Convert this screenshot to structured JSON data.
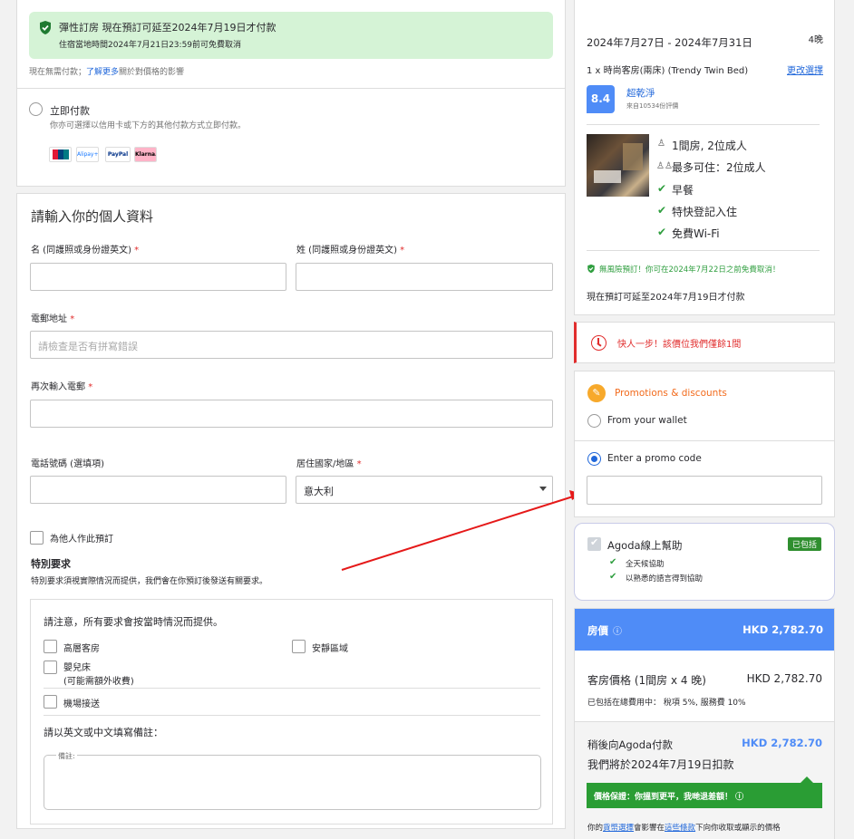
{
  "payment": {
    "flex_title": "彈性訂房 現在預訂可延至2024年7月19日才付款",
    "flex_sub": "住宿當地時間2024年7月21日23:59前可免費取消",
    "no_pay_note": "現在無需付款；",
    "learn_more": "了解更多",
    "no_pay_note2": "關於對價格的影響",
    "pay_now_label": "立即付款",
    "pay_now_desc": "你亦可選擇以信用卡或下方的其他付款方式立即付款。",
    "methods": [
      "UnionPay",
      "Alipay+",
      "PayPal",
      "Klarna."
    ]
  },
  "form": {
    "title": "請輸入你的個人資料",
    "first_name_label": "名 (同護照或身份證英文)",
    "last_name_label": "姓 (同護照或身份證英文)",
    "email_label": "電郵地址",
    "email_placeholder": "請檢查是否有拼寫錯誤",
    "email_confirm_label": "再次輸入電郵",
    "phone_label": "電話號碼 (選填項)",
    "country_label": "居住國家/地區",
    "country_value": "意大利",
    "required_mark": "*",
    "book_for_other": "為他人作此預訂",
    "special_title": "特別要求",
    "special_desc": "特別要求須視實際情況而提供，我們會在你預訂後發送有關要求。",
    "special_note": "請注意，所有要求會按當時情況而提供。",
    "req_high_floor": "高層客房",
    "req_quiet": "安靜區域",
    "req_crib_1": "嬰兒床",
    "req_crib_2": "(可能需額外收費)",
    "req_airport": "機場接送",
    "remarks_title": "請以英文或中文填寫備註：",
    "remarks_label": "備註:"
  },
  "booking": {
    "dates": "2024年7月27日 - 2024年7月31日",
    "nights": "4晚",
    "room": "1 x 時尚客房(兩床) (Trendy Twin Bed)",
    "change": "更改選擇",
    "score": "8.4",
    "score_label": "超乾淨",
    "score_sub": "來自10534份評價",
    "feature_rooms": "1間房, 2位成人",
    "feature_max": "最多可住：2位成人",
    "feature_1": "早餐",
    "feature_2": "特快登記入住",
    "feature_3": "免費Wi-Fi",
    "cancel_note": "無風險預訂！你可在2024年7月22日之前免費取消！",
    "pay_later": "現在預訂可延至2024年7月19日才付款"
  },
  "alert": {
    "text": "快人一步！該價位我們僅餘1間"
  },
  "promo": {
    "title": "Promotions & discounts",
    "wallet": "From your wallet",
    "promo_code": "Enter a promo code"
  },
  "help": {
    "title": "Agoda線上幫助",
    "badge": "已包括",
    "item1": "全天候協助",
    "item2": "以熟悉的語言得到協助"
  },
  "price": {
    "header_label": "房價",
    "header_info": "ⓘ",
    "header_value": "HKD 2,782.70",
    "room_price_label": "客房價格 (1間房 x 4 晚)",
    "room_price_value": "HKD 2,782.70",
    "tax_note": "已包括在總費用中： 稅項 5%, 服務費 10%",
    "pay_agoda_label": "稍後向Agoda付款",
    "pay_agoda_value": "HKD 2,782.70",
    "charge_date": "我們將於2024年7月19日扣款",
    "guarantee": "價格保證：你搵到更平，我哋退差額！ ⓘ",
    "footer_1": "你的",
    "footer_link1": "貨幣選擇",
    "footer_2": "會影響在",
    "footer_link2": "這些條款",
    "footer_3": "下向你收取或顯示的價格"
  },
  "colors": {
    "accent_blue": "#4f8cf7",
    "green": "#2f9e3f",
    "alert_red": "#e12d2d",
    "promo_orange": "#f26b1d"
  }
}
